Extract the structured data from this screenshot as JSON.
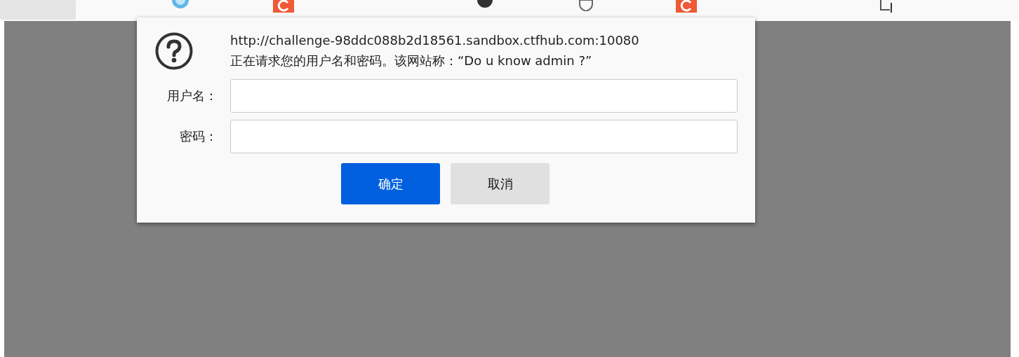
{
  "bookmarks_bar": {
    "items": [
      {
        "kind": "tab"
      },
      {
        "kind": "globe"
      },
      {
        "kind": "red"
      },
      {
        "kind": "cat"
      },
      {
        "kind": "shield"
      },
      {
        "kind": "red"
      },
      {
        "kind": "doc"
      }
    ]
  },
  "auth_dialog": {
    "url": "http://challenge-98ddc088b2d18561.sandbox.ctfhub.com:10080",
    "message": "正在请求您的用户名和密码。该网站称：“Do u know admin ?”",
    "fields": [
      {
        "label": "用户名："
      },
      {
        "label": "密码："
      }
    ],
    "buttons": [
      {
        "label": "确定",
        "kind": "primary"
      },
      {
        "label": "取消",
        "kind": "secondary"
      }
    ]
  }
}
